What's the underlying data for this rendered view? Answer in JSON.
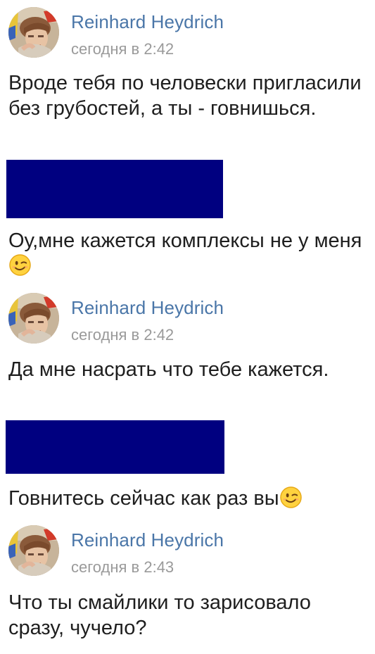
{
  "messages": [
    {
      "author": "Reinhard Heydrich",
      "time": "сегодня в 2:42",
      "avatar_icon": "user-avatar-photo",
      "text": "Вроде тебя по человески пригласили без грубостей, а ты - говнишься."
    },
    {
      "author": "",
      "time": "",
      "text": "Оу,мне кажется комплексы не у меня",
      "emoji": "winking-face-emoji"
    },
    {
      "author": "Reinhard Heydrich",
      "time": "сегодня в 2:42",
      "avatar_icon": "user-avatar-photo",
      "text": "Да мне насрать что тебе кажется."
    },
    {
      "author": "",
      "time": "",
      "text": "Говнитесь сейчас как раз вы",
      "emoji": "winking-face-emoji"
    },
    {
      "author": "Reinhard Heydrich",
      "time": "сегодня в 2:43",
      "avatar_icon": "user-avatar-photo",
      "text": "Что ты смайлики то зарисовало сразу, чучело?"
    }
  ],
  "colors": {
    "author_link": "#4a76a8",
    "timestamp": "#9a9a9a",
    "message_text": "#1e1e1e",
    "redaction": "#000080",
    "background": "#ffffff"
  }
}
